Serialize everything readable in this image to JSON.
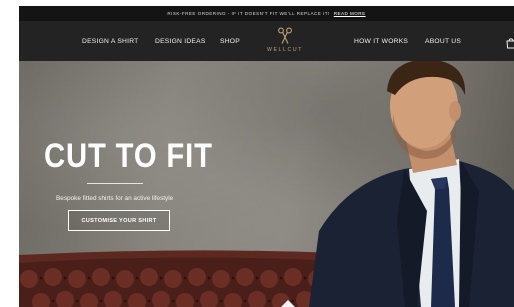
{
  "promo": {
    "text": "RISK-FREE ORDERING - IF IT DOESN'T FIT WE'LL REPLACE IT!",
    "link": "READ MORE"
  },
  "nav": {
    "left_items": [
      "DESIGN A SHIRT",
      "DESIGN IDEAS",
      "SHOP"
    ],
    "right_items": [
      "HOW IT WORKS",
      "ABOUT US"
    ],
    "logo_text": "WELLCUT",
    "cart_icon": "shopping-bag-icon"
  },
  "hero": {
    "title": "CUT TO FIT",
    "subtitle": "Bespoke fitted shirts for an active lifestyle",
    "cta_label": "CUSTOMISE YOUR SHIRT"
  },
  "colors": {
    "nav_bg": "#232323",
    "promo_bg": "#141414",
    "logo_gold": "#b9a27c",
    "tie": "#1d2a4a",
    "suit": "#1b2233"
  }
}
